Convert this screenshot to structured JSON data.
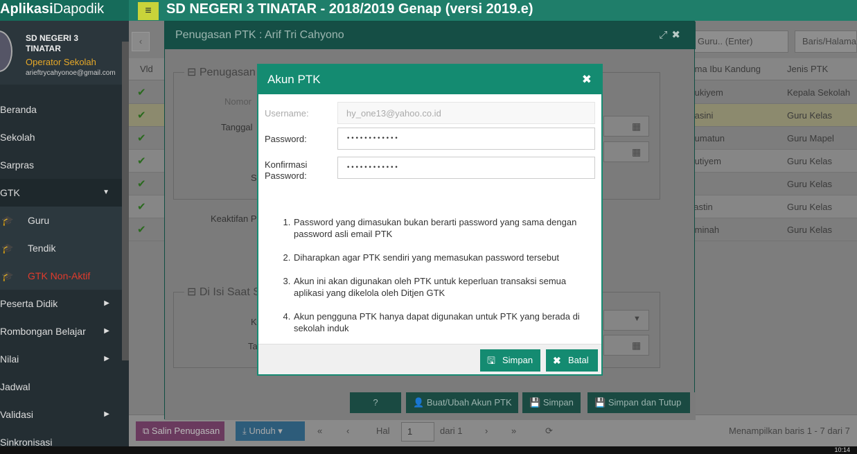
{
  "app": {
    "brand_bold": "Aplikasi",
    "brand_light": "Dapodik",
    "title": "SD NEGERI 3 TINATAR - 2018/2019 Genap (versi 2019.e)"
  },
  "profile": {
    "school": "SD NEGERI 3 TINATAR",
    "role": "Operator Sekolah",
    "email": "arieftrycahyonoe@gmail.com"
  },
  "sidebar": {
    "items": [
      {
        "label": "Beranda"
      },
      {
        "label": "Sekolah"
      },
      {
        "label": "Sarpras"
      },
      {
        "label": "GTK"
      },
      {
        "label": "Guru"
      },
      {
        "label": "Tendik"
      },
      {
        "label": "GTK Non-Aktif"
      },
      {
        "label": "Peserta Didik"
      },
      {
        "label": "Rombongan Belajar"
      },
      {
        "label": "Nilai"
      },
      {
        "label": "Jadwal"
      },
      {
        "label": "Validasi"
      },
      {
        "label": "Sinkronisasi"
      }
    ]
  },
  "grid": {
    "search_placeholder": "Guru.. (Enter)",
    "rows_placeholder": "Baris/Halaman",
    "columns": {
      "vld": "Vld",
      "ibu": "Nama Ibu Kandung",
      "jenis": "Jenis PTK"
    },
    "rows": [
      {
        "ibu": "Sukiyem",
        "jenis": "Kepala Sekolah"
      },
      {
        "ibu": "Kasini",
        "jenis": "Guru Kelas"
      },
      {
        "ibu": "Sumatun",
        "jenis": "Guru Mapel"
      },
      {
        "ibu": "Sutiyem",
        "jenis": "Guru Kelas"
      },
      {
        "ibu": "",
        "jenis": "Guru Kelas"
      },
      {
        "ibu": "Lastin",
        "jenis": "Guru Kelas"
      },
      {
        "ibu": "Aminah",
        "jenis": "Guru Kelas"
      }
    ],
    "bottom": {
      "copy_label": "Salin Penugasan",
      "download_label": "Unduh",
      "page_label": "Hal",
      "page_value": "1",
      "page_of": "dari 1",
      "summary": "Menampilkan baris 1 - 7 dari 7"
    }
  },
  "window": {
    "title": "Penugasan PTK : Arif Tri Cahyono",
    "legend1": "Penugasan",
    "legend2": "Di Isi Saat S",
    "labels": {
      "nomor": "Nomor",
      "tanggal": "Tanggal",
      "s": "S",
      "keaktifan": "Keaktifan P",
      "k": "K",
      "ta": "Ta"
    },
    "footer": {
      "help": "?",
      "akun": "Buat/Ubah Akun PTK",
      "simpan": "Simpan",
      "simpan_tutup": "Simpan dan Tutup"
    }
  },
  "modal": {
    "title": "Akun PTK",
    "username_label": "Username:",
    "username_value": "hy_one13@yahoo.co.id",
    "password_label": "Password:",
    "password_value": "••••••••••••",
    "confirm_label_1": "Konfirmasi",
    "confirm_label_2": "Password:",
    "confirm_value": "••••••••••••",
    "notes": [
      "Password yang dimasukan bukan berarti password yang sama dengan password asli email PTK",
      "Diharapkan agar PTK sendiri yang memasukan password tersebut",
      "Akun ini akan digunakan oleh PTK untuk keperluan transaksi semua aplikasi yang dikelola oleh Ditjen GTK",
      "Akun pengguna PTK hanya dapat digunakan untuk PTK yang berada di sekolah induk"
    ],
    "save_label": "Simpan",
    "cancel_label": "Batal"
  },
  "taskbar": {
    "time": "10:14"
  },
  "colors": {
    "accent": "#148b71",
    "brand": "#1f7e6a",
    "sidebar": "#242e33",
    "warning": "#e7a928",
    "danger": "#e23b2c"
  }
}
